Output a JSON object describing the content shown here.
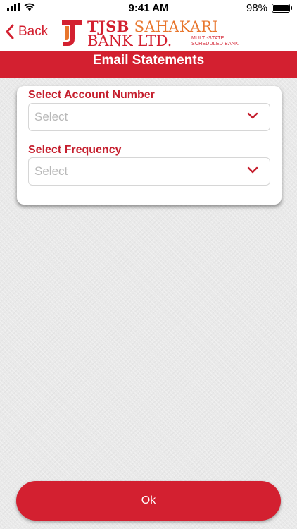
{
  "status_bar": {
    "time": "9:41 AM",
    "battery": "98%",
    "battery_level": 0.98,
    "icons": [
      "signal-icon",
      "wifi-icon",
      "battery-icon"
    ]
  },
  "nav": {
    "back_label": "Back",
    "back_icon": "chevron-left-icon",
    "logo": {
      "line1_a": "TJSB",
      "line1_b": "SAHAKARI",
      "line2": "BANK LTD.",
      "tag_line1": "MULTI-STATE",
      "tag_line2": "SCHEDULED BANK"
    }
  },
  "page": {
    "title": "Email Statements"
  },
  "form": {
    "account_label": "Select Account Number",
    "account_placeholder": "Select",
    "frequency_label": "Select Frequency",
    "frequency_placeholder": "Select",
    "dropdown_icon": "chevron-down-icon"
  },
  "actions": {
    "ok_label": "Ok"
  },
  "colors": {
    "brand_red": "#d32030",
    "brand_orange": "#e8762d",
    "placeholder_gray": "#b8b8b8",
    "background_gray": "#e9e9e9"
  }
}
